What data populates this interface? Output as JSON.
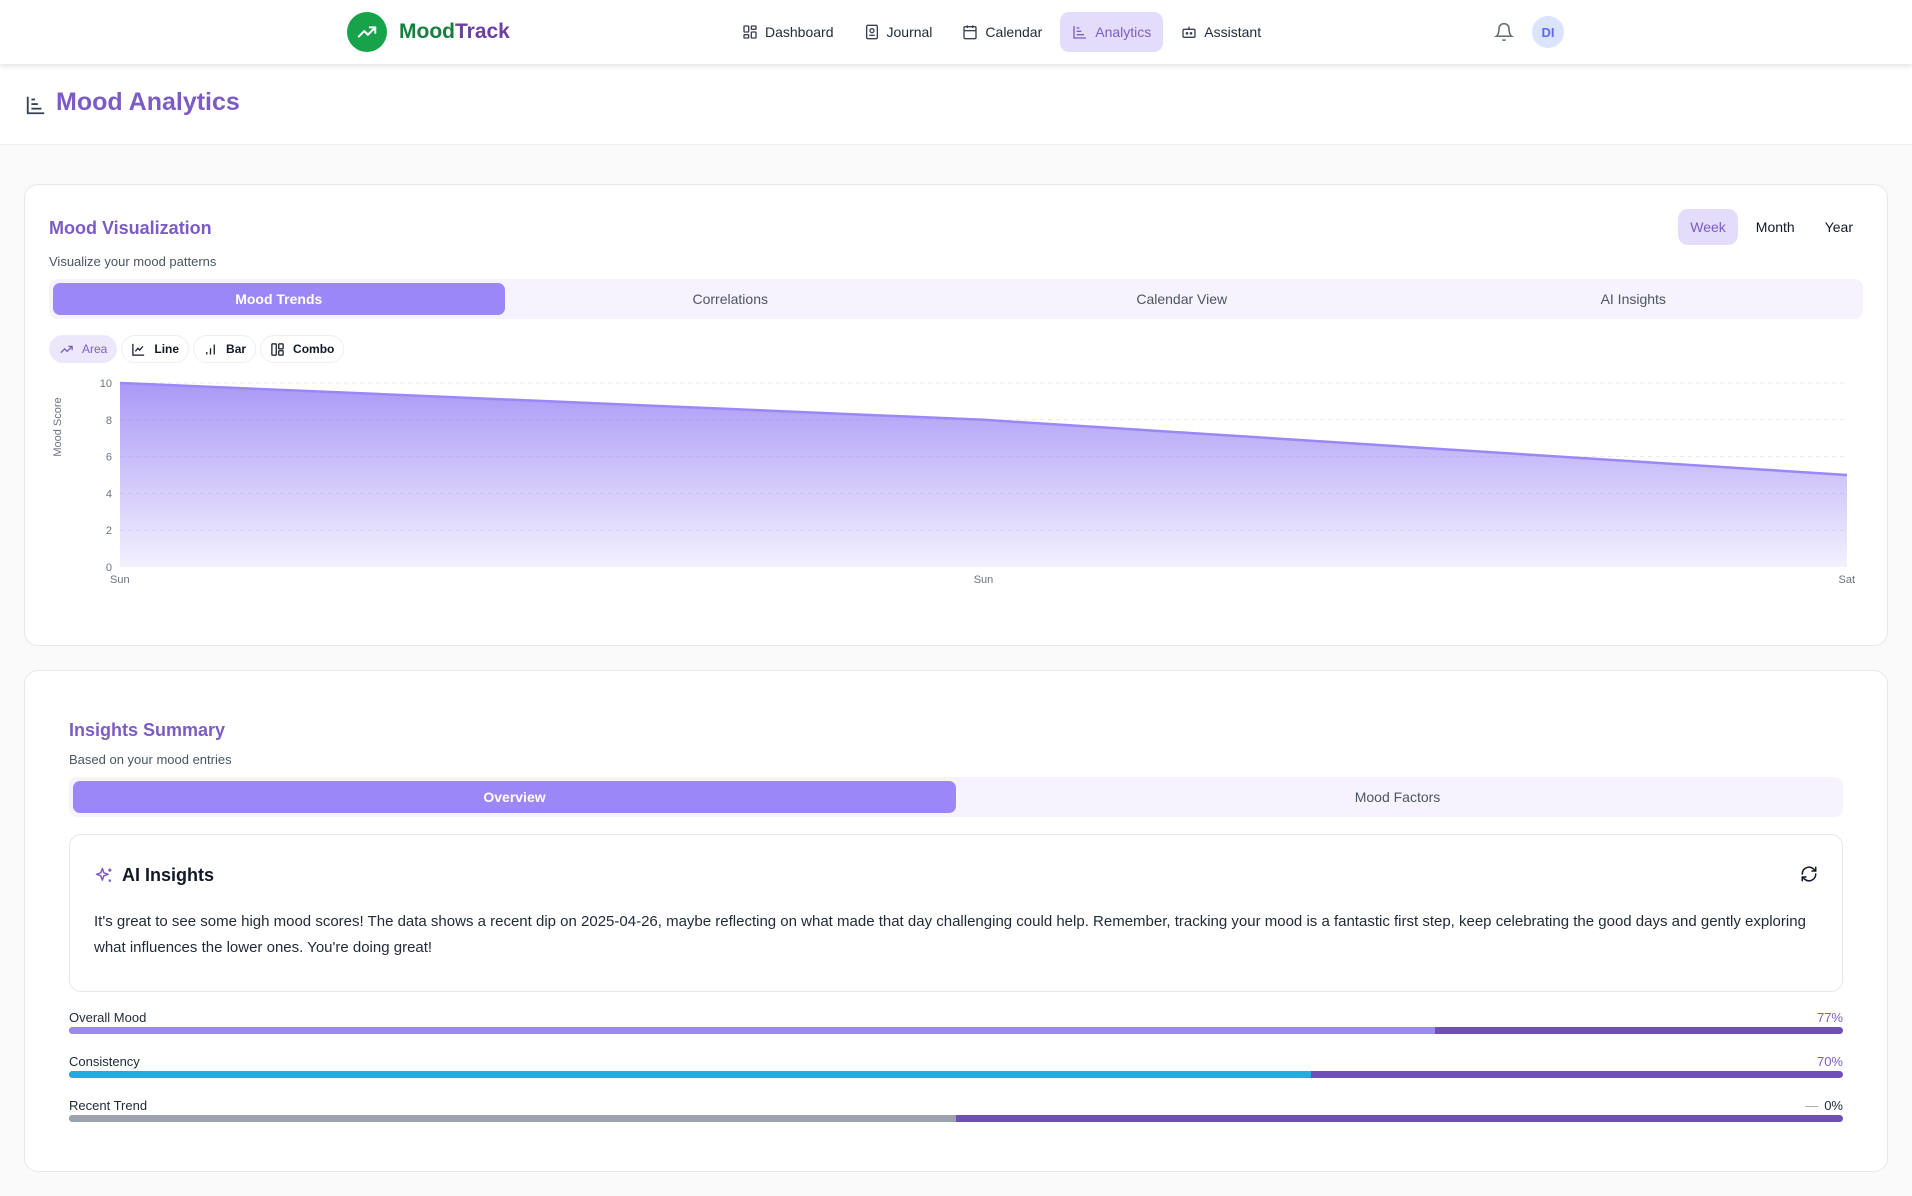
{
  "app": {
    "logo_part1": "Mood",
    "logo_part2": "Track",
    "logo_icon": "trending-up-icon"
  },
  "nav": {
    "items": [
      {
        "label": "Dashboard",
        "icon": "grid-icon"
      },
      {
        "label": "Journal",
        "icon": "book-icon"
      },
      {
        "label": "Calendar",
        "icon": "calendar-icon"
      },
      {
        "label": "Analytics",
        "icon": "chart-icon",
        "active": true
      },
      {
        "label": "Assistant",
        "icon": "bot-icon"
      }
    ],
    "avatar": "DI"
  },
  "page": {
    "title": "Mood Analytics"
  },
  "viz": {
    "title": "Mood Visualization",
    "subtitle": "Visualize your mood patterns",
    "ranges": [
      "Week",
      "Month",
      "Year"
    ],
    "active_range": "Week",
    "tabs": [
      "Mood Trends",
      "Correlations",
      "Calendar View",
      "AI Insights"
    ],
    "active_tab": "Mood Trends",
    "chart_types": [
      "Area",
      "Line",
      "Bar",
      "Combo"
    ],
    "active_chart_type": "Area"
  },
  "chart_data": {
    "type": "area",
    "x": [
      "Sun",
      "Sun",
      "Sat"
    ],
    "values": [
      10,
      8,
      5
    ],
    "ylabel": "Mood Score",
    "xlabel": "",
    "ylim": [
      0,
      10
    ],
    "yticks": [
      0,
      2,
      4,
      6,
      8,
      10
    ],
    "grid": true,
    "colors": {
      "line": "#9b87f5",
      "fill": "#9b87f5"
    }
  },
  "insights": {
    "title": "Insights Summary",
    "subtitle": "Based on your mood entries",
    "tabs": [
      "Overview",
      "Mood Factors"
    ],
    "active_tab": "Overview",
    "ai_title": "AI Insights",
    "ai_text": "It's great to see some high mood scores! The data shows a recent dip on 2025-04-26, maybe reflecting on what made that day challenging could help. Remember, tracking your mood is a fantastic first step, keep celebrating the good days and gently exploring what influences the lower ones. You're doing great!",
    "metrics": [
      {
        "label": "Overall Mood",
        "value": "77%",
        "fraction": 0.77,
        "color": "#9b87f5"
      },
      {
        "label": "Consistency",
        "value": "70%",
        "fraction": 0.7,
        "color": "#1eaedb"
      },
      {
        "label": "Recent Trend",
        "value": "0%",
        "fraction": 0.5,
        "color": "#9ca3af",
        "prefix": "—"
      }
    ]
  }
}
